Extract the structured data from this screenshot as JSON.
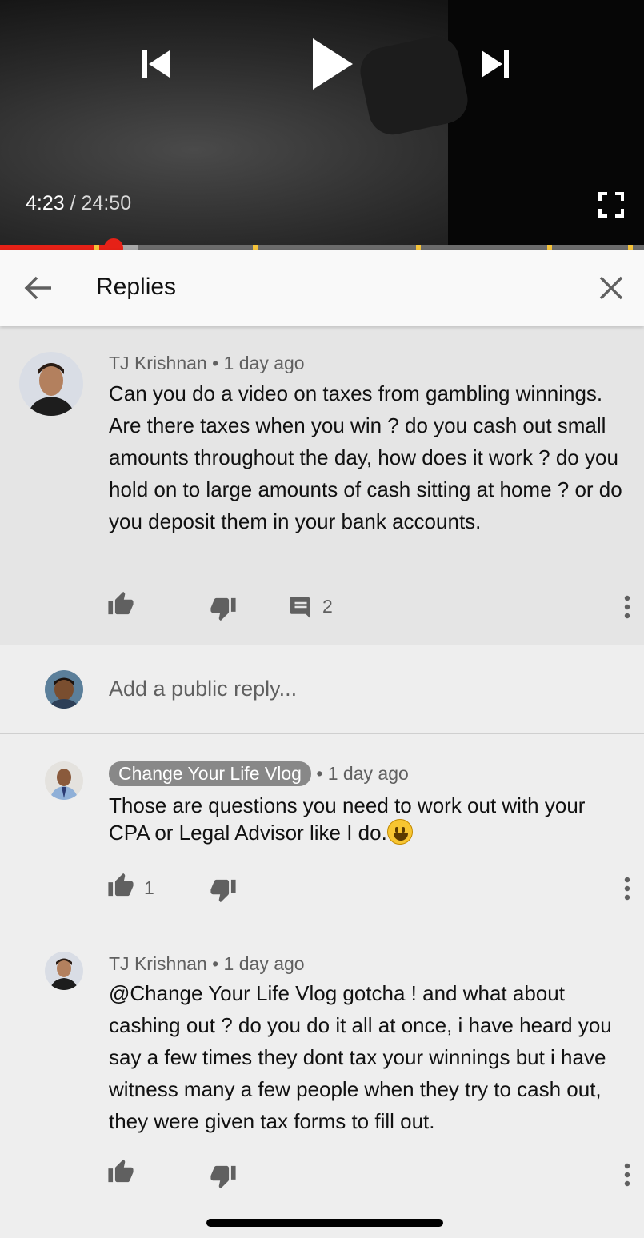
{
  "player": {
    "current_time": "4:23",
    "separator": "/",
    "duration": "24:50",
    "progress": 0.177
  },
  "header": {
    "title": "Replies"
  },
  "main_comment": {
    "author": "TJ Krishnan",
    "age": "• 1 day ago",
    "text": "Can you do a video on taxes from gambling winnings. Are there taxes when you win ? do you cash out small amounts throughout the day, how does it work ? do you hold on to large amounts of cash sitting at home ? or do you deposit them in your bank accounts.",
    "reply_count": "2"
  },
  "add_reply": {
    "placeholder": "Add a public reply..."
  },
  "replies": [
    {
      "author": "Change Your Life Vlog",
      "age": "• 1 day ago",
      "text": "Those are questions you need to work out with your CPA or Legal Advisor like I do.",
      "likes": "1"
    },
    {
      "author": "TJ Krishnan",
      "age": "• 1 day ago",
      "text": "@Change Your Life Vlog gotcha ! and what about cashing out ? do you do it all at once, i have heard you say a few times they dont tax your winnings but i have witness many a few people when they try to cash out, they were given tax forms to fill out."
    }
  ],
  "colors": {
    "accent": "#e62117",
    "chapter_marker": "#f6c43a",
    "badge": "#888888"
  }
}
